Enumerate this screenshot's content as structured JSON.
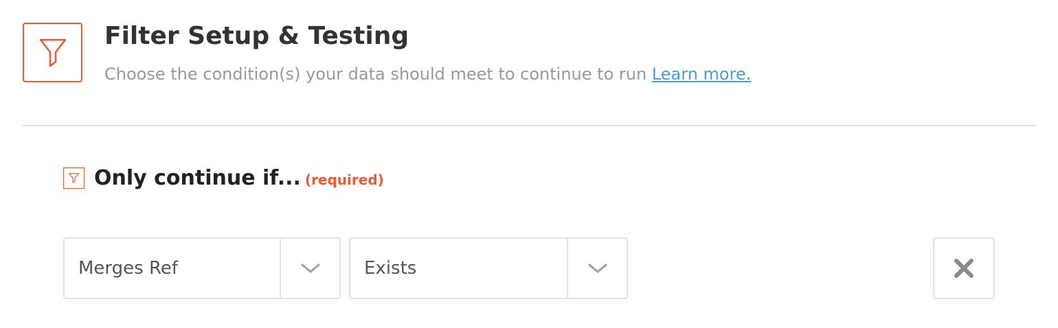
{
  "header": {
    "icon": "filter-icon",
    "title": "Filter Setup & Testing",
    "subtitle": "Choose the condition(s) your data should meet to continue to run",
    "learn_more": "Learn more."
  },
  "condition_section": {
    "icon": "filter-icon",
    "heading": "Only continue if...",
    "required_label": "(required)"
  },
  "condition_row": {
    "field_select": {
      "value": "Merges Ref",
      "icon": "chevron-down-icon"
    },
    "operator_select": {
      "value": "Exists",
      "icon": "chevron-down-icon"
    },
    "remove_icon": "close-icon"
  },
  "colors": {
    "accent": "#ee5a34",
    "link": "#4a9bd9",
    "muted_text": "#999999",
    "border": "#e3e3e3"
  }
}
